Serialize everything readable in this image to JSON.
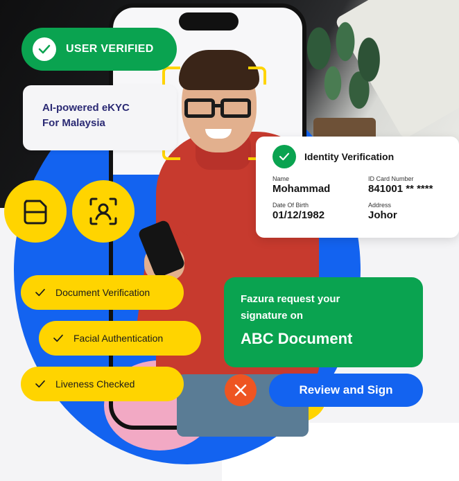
{
  "status_pill": {
    "label": "USER VERIFIED",
    "icon": "check-icon"
  },
  "promo_card": {
    "line1": "AI-powered eKYC",
    "line2": "For Malaysia"
  },
  "identity_card": {
    "title": "Identity Verification",
    "icon": "check-icon",
    "fields": {
      "name": {
        "label": "Name",
        "value": "Mohammad"
      },
      "id_number": {
        "label": "ID Card Number",
        "value": "841001 ** ****"
      },
      "dob": {
        "label": "Date Of Birth",
        "value": "01/12/1982"
      },
      "address": {
        "label": "Address",
        "value": "Johor"
      }
    }
  },
  "icons": {
    "document": "document-scan-icon",
    "face": "face-scan-icon"
  },
  "features": [
    {
      "label": "Document Verification",
      "icon": "check-icon"
    },
    {
      "label": "Facial Authentication",
      "icon": "check-icon"
    },
    {
      "label": "Liveness Checked",
      "icon": "check-icon"
    }
  ],
  "signature_request": {
    "line1": "Fazura request your",
    "line2": "signature on",
    "document": "ABC Document",
    "review_label": "Review and Sign",
    "reject_icon": "close-icon"
  },
  "colors": {
    "green": "#0aa350",
    "blue": "#1363f0",
    "yellow": "#ffd400",
    "navy": "#2b2a74",
    "red": "#ee5522"
  }
}
